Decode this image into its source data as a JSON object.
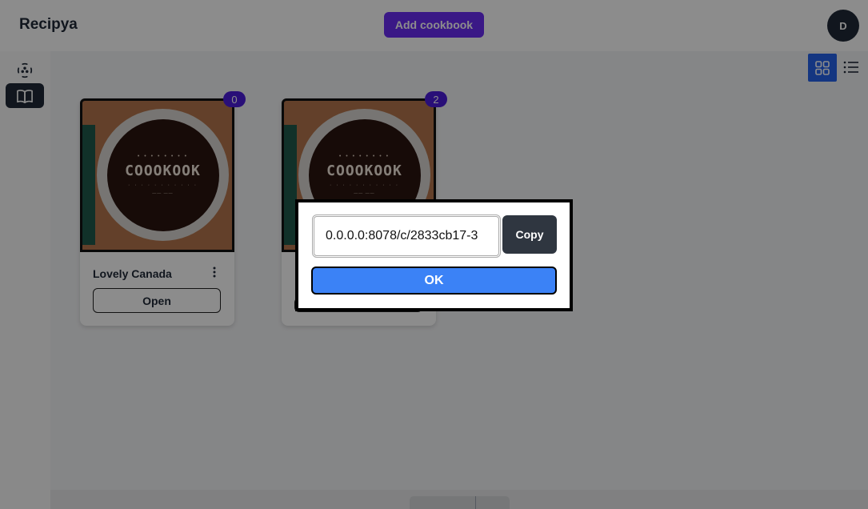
{
  "header": {
    "brand": "Recipya",
    "add_cookbook_label": "Add cookbook",
    "avatar_initial": "D"
  },
  "sidebar": {
    "items": [
      {
        "icon": "scan-dots-icon",
        "active": false
      },
      {
        "icon": "open-book-icon",
        "active": true
      }
    ]
  },
  "view_toggle": {
    "options": [
      "grid-icon",
      "list-icon"
    ],
    "selected": "grid-icon"
  },
  "cookbooks": [
    {
      "title": "Lovely Canada",
      "count": "0",
      "open_label": "Open",
      "cover_word": "COOOKOOK"
    },
    {
      "title": "",
      "count": "2",
      "open_label": "",
      "cover_word": "COOOKOOK"
    }
  ],
  "share_dialog": {
    "url_value": "0.0.0.0:8078/c/2833cb17-3",
    "copy_label": "Copy",
    "ok_label": "OK"
  },
  "colors": {
    "accent": "#6b2cf5",
    "badge": "#4c1ddb",
    "primary_blue": "#3b82f6",
    "grid_toggle": "#2563eb",
    "dark": "#1f2937"
  }
}
